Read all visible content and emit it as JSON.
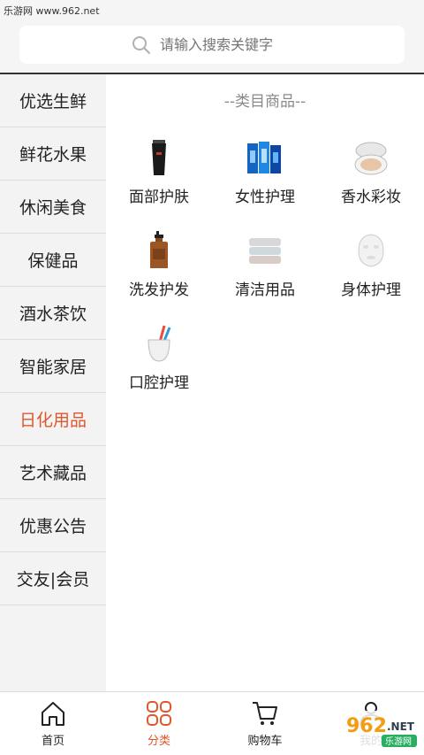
{
  "watermark_top": "乐游网 www.962.net",
  "search": {
    "placeholder": "请输入搜索关键字"
  },
  "sidebar": {
    "items": [
      {
        "label": "优选生鲜",
        "active": false
      },
      {
        "label": "鲜花水果",
        "active": false
      },
      {
        "label": "休闲美食",
        "active": false
      },
      {
        "label": "保健品",
        "active": false
      },
      {
        "label": "酒水茶饮",
        "active": false
      },
      {
        "label": "智能家居",
        "active": false
      },
      {
        "label": "日化用品",
        "active": true
      },
      {
        "label": "艺术藏品",
        "active": false
      },
      {
        "label": "优惠公告",
        "active": false
      },
      {
        "label": "交友|会员",
        "active": false
      }
    ]
  },
  "main": {
    "section_title": "--类目商品--",
    "categories": [
      {
        "label": "面部护肤",
        "icon": "face-cleanser-icon"
      },
      {
        "label": "女性护理",
        "icon": "feminine-care-icon"
      },
      {
        "label": "香水彩妆",
        "icon": "cushion-compact-icon"
      },
      {
        "label": "洗发护发",
        "icon": "shampoo-bottle-icon"
      },
      {
        "label": "清洁用品",
        "icon": "towels-icon"
      },
      {
        "label": "身体护理",
        "icon": "face-mask-icon"
      },
      {
        "label": "口腔护理",
        "icon": "toothbrush-cup-icon"
      }
    ]
  },
  "bottom_nav": {
    "items": [
      {
        "label": "首页",
        "icon": "home-icon",
        "active": false
      },
      {
        "label": "分类",
        "icon": "category-grid-icon",
        "active": true
      },
      {
        "label": "购物车",
        "icon": "cart-icon",
        "active": false
      },
      {
        "label": "我的",
        "icon": "user-icon",
        "active": false
      }
    ]
  },
  "watermark_bottom": {
    "brand": "962",
    "suffix": ".NET",
    "sub": "乐游网"
  },
  "colors": {
    "accent": "#e0572b",
    "sidebar_bg": "#f3f3f3",
    "header_bg": "#f5f5f5"
  }
}
